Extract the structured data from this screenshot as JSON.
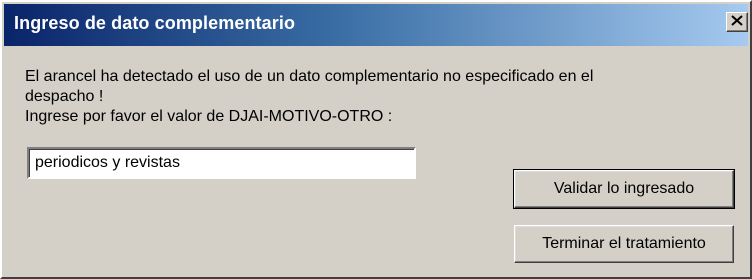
{
  "dialog": {
    "title": "Ingreso de dato complementario",
    "close_label": "X",
    "message_line1": "El arancel ha detectado el uso de un dato complementario no especificado en el",
    "message_line2": "despacho !",
    "message_line3": "Ingrese por favor el valor de DJAI-MOTIVO-OTRO :",
    "input_value": "periodicos y revistas",
    "validate_button": "Validar lo ingresado",
    "terminate_button": "Terminar el tratamiento"
  }
}
